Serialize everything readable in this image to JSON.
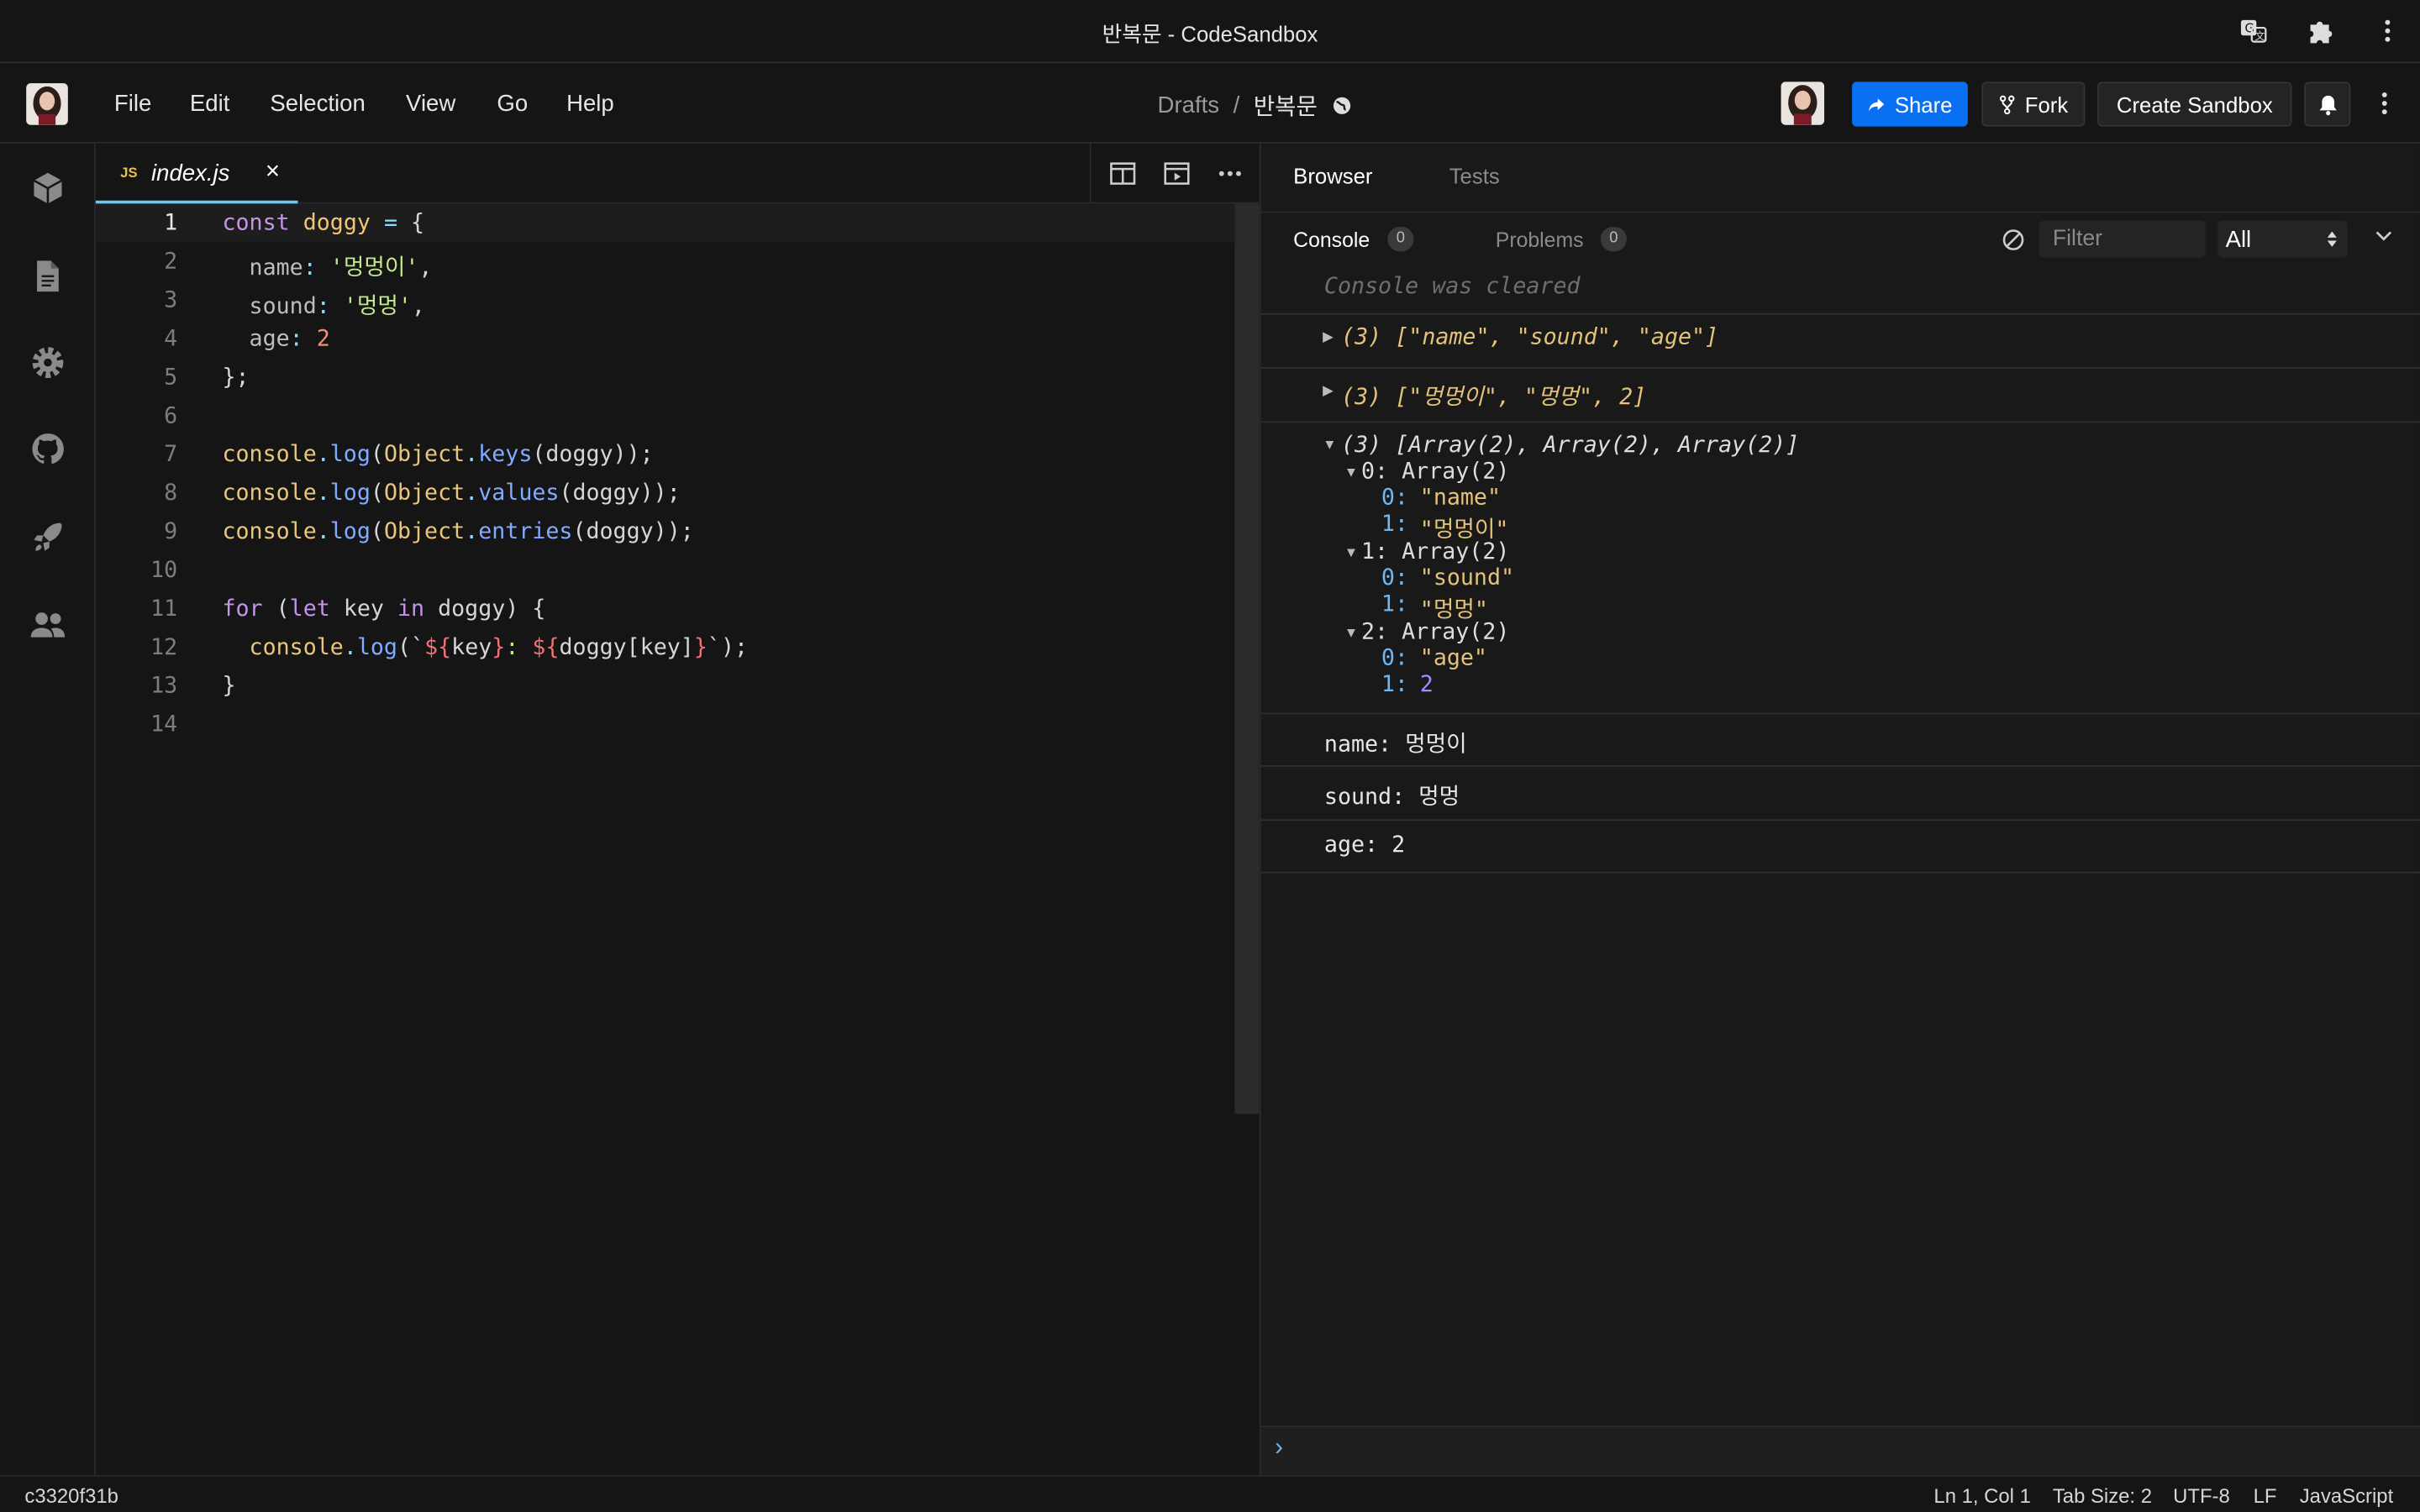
{
  "window": {
    "title": "반복문 - CodeSandbox"
  },
  "menu": {
    "file": "File",
    "edit": "Edit",
    "selection": "Selection",
    "view": "View",
    "go": "Go",
    "help": "Help"
  },
  "breadcrumb": {
    "folder": "Drafts",
    "separator": "/",
    "sandbox": "반복문"
  },
  "header_buttons": {
    "share": "Share",
    "fork": "Fork",
    "create": "Create Sandbox"
  },
  "editor": {
    "tab_badge": "JS",
    "tab_name": "index.js",
    "close_glyph": "×",
    "line_numbers": [
      "1",
      "2",
      "3",
      "4",
      "5",
      "6",
      "7",
      "8",
      "9",
      "10",
      "11",
      "12",
      "13",
      "14"
    ]
  },
  "preview": {
    "tab_browser": "Browser",
    "tab_tests": "Tests",
    "console_tab": "Console",
    "console_count": "0",
    "problems_tab": "Problems",
    "problems_count": "0",
    "filter_placeholder": "Filter",
    "level_select": "All",
    "cleared_message": "Console was cleared",
    "log_keys": "(3) [\"name\", \"sound\", \"age\"]",
    "log_values": "(3) [\"멍멍이\", \"멍멍\", 2]",
    "log_entries_header": "(3) [Array(2), Array(2), Array(2)]",
    "entries": [
      {
        "label": "0: Array(2)",
        "k0": "0:",
        "v0": "\"name\"",
        "k1": "1:",
        "v1": "\"멍멍이\""
      },
      {
        "label": "1: Array(2)",
        "k0": "0:",
        "v0": "\"sound\"",
        "k1": "1:",
        "v1": "\"멍멍\""
      },
      {
        "label": "2: Array(2)",
        "k0": "0:",
        "v0": "\"age\"",
        "k1": "1:",
        "v1": "2"
      }
    ],
    "output_1": "name: 멍멍이",
    "output_2": "sound: 멍멍",
    "output_3": "age: 2",
    "prompt": "›"
  },
  "status": {
    "commit": "c3320f31b",
    "position": "Ln 1, Col 1",
    "tab_size": "Tab Size: 2",
    "encoding": "UTF-8",
    "eol": "LF",
    "language": "JavaScript"
  },
  "colors": {
    "accent": "#0971f1",
    "background": "#151515",
    "panel": "#191919"
  },
  "icons": [
    "translate-icon",
    "puzzle-icon",
    "more-vertical-icon",
    "share-arrow-icon",
    "fork-icon",
    "bell-icon",
    "globe-icon",
    "box-icon",
    "file-icon",
    "gear-icon",
    "github-icon",
    "rocket-icon",
    "users-icon",
    "split-view-icon",
    "preview-icon",
    "more-horizontal-icon",
    "clear-console-icon",
    "chevron-down-icon"
  ]
}
